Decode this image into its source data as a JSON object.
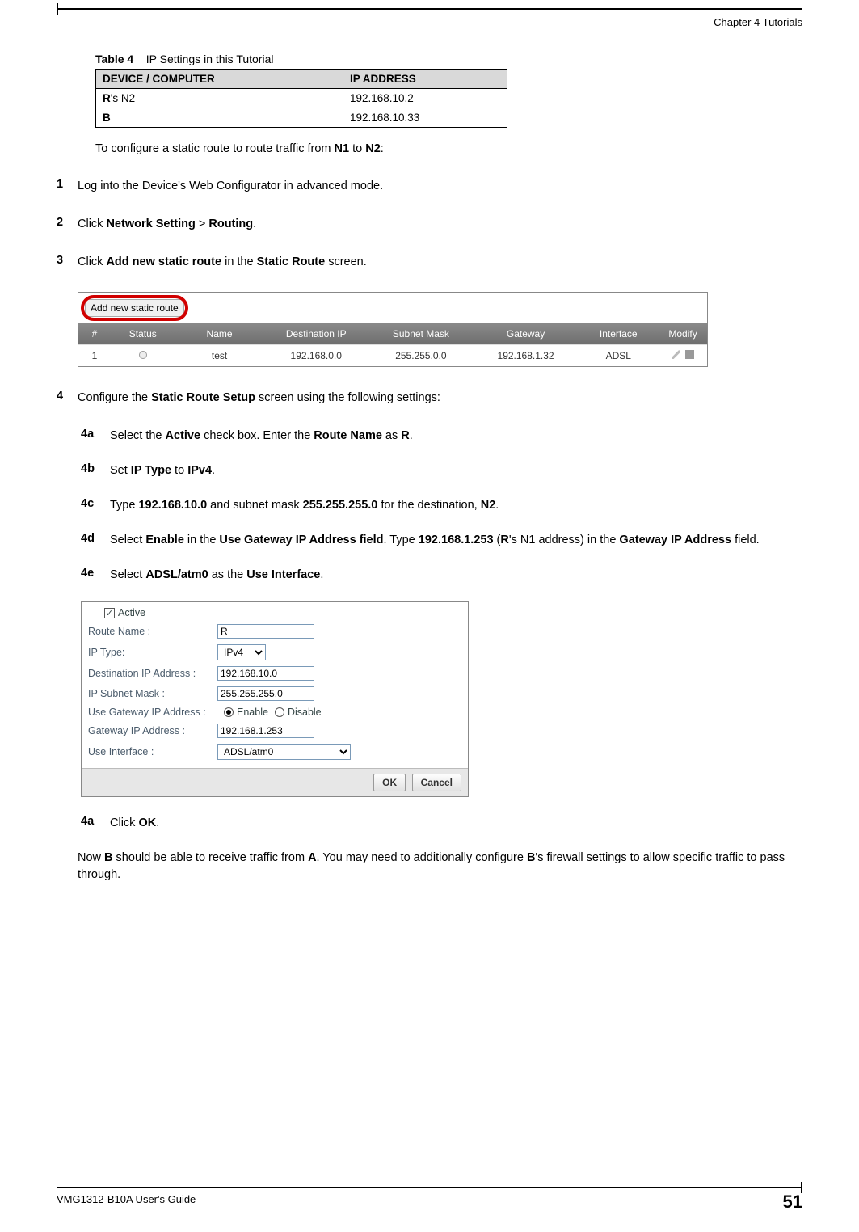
{
  "header": {
    "chapter": " Chapter 4 Tutorials"
  },
  "table": {
    "label": "Table 4",
    "caption": "IP Settings in this Tutorial",
    "head_device": "DEVICE / COMPUTER",
    "head_ip": "IP ADDRESS",
    "rows": [
      {
        "device_prefix_bold": "R",
        "device_rest": "'s N2",
        "ip": "192.168.10.2"
      },
      {
        "device_prefix_bold": "B",
        "device_rest": "",
        "ip": "192.168.10.33"
      }
    ]
  },
  "intro": {
    "pre": "To configure a static route to route traffic from ",
    "b1": "N1",
    "mid": " to ",
    "b2": "N2",
    "post": ":"
  },
  "steps": {
    "s1": {
      "num": "1",
      "text": "Log into the Device's Web Configurator in advanced mode."
    },
    "s2": {
      "num": "2",
      "pre": "Click ",
      "b1": "Network Setting",
      "mid": " > ",
      "b2": "Routing",
      "post": "."
    },
    "s3": {
      "num": "3",
      "pre": "Click ",
      "b1": "Add new static route",
      "mid": " in the ",
      "b2": "Static Route",
      "post": " screen."
    },
    "s4": {
      "num": "4",
      "pre": "Configure the ",
      "b1": "Static Route Setup",
      "post": " screen using the following settings:"
    }
  },
  "shot1": {
    "add_btn": "Add new static route",
    "headers": {
      "hash": "#",
      "status": "Status",
      "name": "Name",
      "dest": "Destination IP",
      "mask": "Subnet Mask",
      "gw": "Gateway",
      "if": "Interface",
      "mod": "Modify"
    },
    "row": {
      "hash": "1",
      "name": "test",
      "dest": "192.168.0.0",
      "mask": "255.255.0.0",
      "gw": "192.168.1.32",
      "if": "ADSL"
    }
  },
  "subs": {
    "a": {
      "num": "4a",
      "pre": "Select the ",
      "b1": "Active",
      "mid": " check box. Enter the ",
      "b2": "Route Name",
      "mid2": " as ",
      "b3": "R",
      "post": "."
    },
    "b": {
      "num": "4b",
      "pre": "Set ",
      "b1": "IP Type",
      "mid": " to ",
      "b2": "IPv4",
      "post": "."
    },
    "c": {
      "num": "4c",
      "pre": "Type ",
      "b1": "192.168.10.0",
      "mid": " and subnet mask ",
      "b2": "255.255.255.0",
      "mid2": " for the destination, ",
      "b3": "N2",
      "post": "."
    },
    "d": {
      "num": "4d",
      "pre": "Select ",
      "b1": "Enable",
      "mid": " in the ",
      "b2": "Use Gateway IP Address field",
      "mid2": ". Type ",
      "b3": "192.168.1.253",
      "mid3": " (",
      "b4": "R",
      "mid4": "'s N1 address) in the ",
      "b5": "Gateway IP Address",
      "post": " field."
    },
    "e": {
      "num": "4e",
      "pre": "Select ",
      "b1": "ADSL/atm0",
      "mid": " as the ",
      "b2": "Use Interface",
      "post": "."
    },
    "f": {
      "num": "4a",
      "pre": "Click ",
      "b1": "OK",
      "post": "."
    }
  },
  "shot2": {
    "active_label": "Active",
    "labels": {
      "route_name": "Route Name :",
      "ip_type": "IP Type:",
      "dest_ip": "Destination IP Address :",
      "subnet": "IP Subnet Mask :",
      "use_gw": "Use Gateway IP Address :",
      "gw_ip": "Gateway IP Address :",
      "use_if": "Use Interface :"
    },
    "values": {
      "route_name": "R",
      "ip_type": "IPv4",
      "dest_ip": "192.168.10.0",
      "subnet": "255.255.255.0",
      "gw_ip": "192.168.1.253",
      "use_if": "ADSL/atm0"
    },
    "radio": {
      "enable": "Enable",
      "disable": "Disable"
    },
    "buttons": {
      "ok": "OK",
      "cancel": "Cancel"
    }
  },
  "concluding": {
    "pre": "Now ",
    "b1": "B",
    "mid": " should be able to receive traffic from ",
    "b2": "A",
    "mid2": ". You may need to additionally configure ",
    "b3": "B",
    "post": "'s firewall settings to allow specific traffic to pass through."
  },
  "footer": {
    "left": "VMG1312-B10A User's Guide",
    "right": "51"
  }
}
